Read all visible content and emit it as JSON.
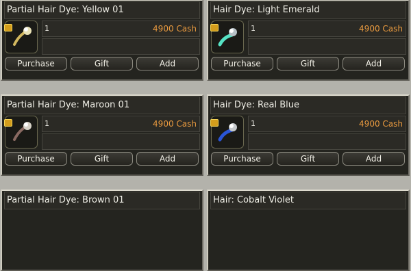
{
  "items": [
    {
      "title": "Partial Hair Dye: Yellow 01",
      "icon": "yellow-hair-dye-icon",
      "quantity": "1",
      "price": "4900 Cash",
      "accent": "#d2b85f"
    },
    {
      "title": "Hair Dye: Light Emerald",
      "icon": "emerald-hair-dye-icon",
      "quantity": "1",
      "price": "4900 Cash",
      "accent": "#56e3c5"
    },
    {
      "title": "Partial Hair Dye: Maroon 01",
      "icon": "maroon-hair-dye-icon",
      "quantity": "1",
      "price": "4900 Cash",
      "accent": "#8a6a62"
    },
    {
      "title": "Hair Dye: Real Blue",
      "icon": "blue-hair-dye-icon",
      "quantity": "1",
      "price": "4900 Cash",
      "accent": "#2a55d6"
    },
    {
      "title": "Partial Hair Dye: Brown 01",
      "icon": "brown-hair-dye-icon",
      "quantity": "",
      "price": "",
      "accent": "#8b5a2b"
    },
    {
      "title": "Hair: Cobalt Violet",
      "icon": "violet-hair-icon",
      "quantity": "",
      "price": "",
      "accent": "#6b5ad0"
    }
  ],
  "buttons": {
    "purchase": "Purchase",
    "gift": "Gift",
    "add": "Add"
  }
}
